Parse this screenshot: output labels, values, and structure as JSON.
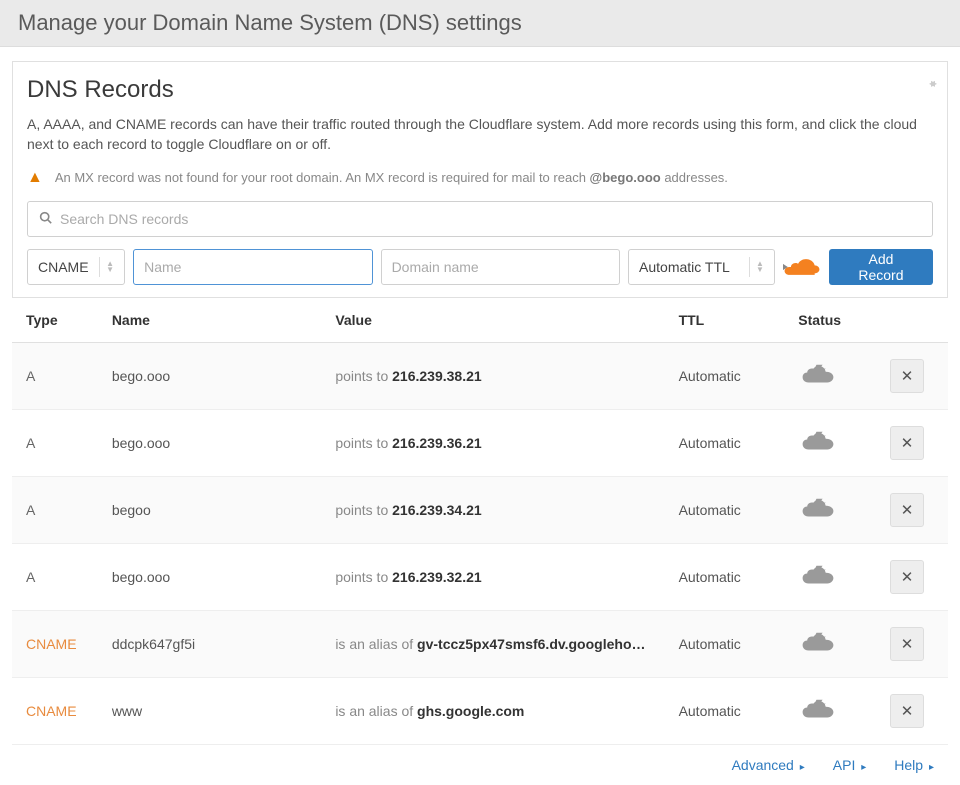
{
  "header": {
    "title": "Manage your Domain Name System (DNS) settings"
  },
  "card": {
    "title": "DNS Records",
    "description": "A, AAAA, and CNAME records can have their traffic routed through the Cloudflare system. Add more records using this form, and click the cloud next to each record to toggle Cloudflare on or off.",
    "warning_prefix": "An MX record was not found for your root domain. An MX record is required for mail to reach ",
    "warning_domain": "@bego.ooo",
    "warning_suffix": " addresses."
  },
  "search": {
    "placeholder": "Search DNS records"
  },
  "form": {
    "type": "CNAME",
    "name_placeholder": "Name",
    "domain_placeholder": "Domain name",
    "ttl": "Automatic TTL",
    "add_button": "Add Record"
  },
  "columns": {
    "type": "Type",
    "name": "Name",
    "value": "Value",
    "ttl": "TTL",
    "status": "Status"
  },
  "value_labels": {
    "points_to": "points to ",
    "alias_of": "is an alias of "
  },
  "records": [
    {
      "type": "A",
      "name": "bego.ooo",
      "value_prefix": "points_to",
      "value": "216.239.38.21",
      "ttl": "Automatic"
    },
    {
      "type": "A",
      "name": "bego.ooo",
      "value_prefix": "points_to",
      "value": "216.239.36.21",
      "ttl": "Automatic"
    },
    {
      "type": "A",
      "name": "begoo",
      "value_prefix": "points_to",
      "value": "216.239.34.21",
      "ttl": "Automatic"
    },
    {
      "type": "A",
      "name": "bego.ooo",
      "value_prefix": "points_to",
      "value": "216.239.32.21",
      "ttl": "Automatic"
    },
    {
      "type": "CNAME",
      "name": "ddcpk647gf5i",
      "value_prefix": "alias_of",
      "value": "gv-tccz5px47smsf6.dv.googleho…",
      "ttl": "Automatic"
    },
    {
      "type": "CNAME",
      "name": "www",
      "value_prefix": "alias_of",
      "value": "ghs.google.com",
      "ttl": "Automatic"
    }
  ],
  "footer": {
    "advanced": "Advanced",
    "api": "API",
    "help": "Help"
  }
}
